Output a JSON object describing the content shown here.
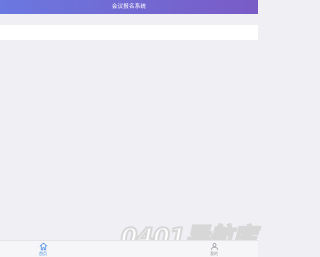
{
  "app": {
    "title": "会议报名系统"
  },
  "tabs": [
    {
      "label": "首页",
      "icon": "home-icon",
      "active": true
    },
    {
      "label": "我的",
      "icon": "user-icon",
      "active": false
    }
  ],
  "watermark": {
    "text": "0401导航库"
  },
  "colors": {
    "header_start": "#6a78e0",
    "header_end": "#7a5bc6",
    "background": "#efeff4",
    "active_tab": "#4a8be0",
    "inactive_tab": "#9a9aa0"
  }
}
